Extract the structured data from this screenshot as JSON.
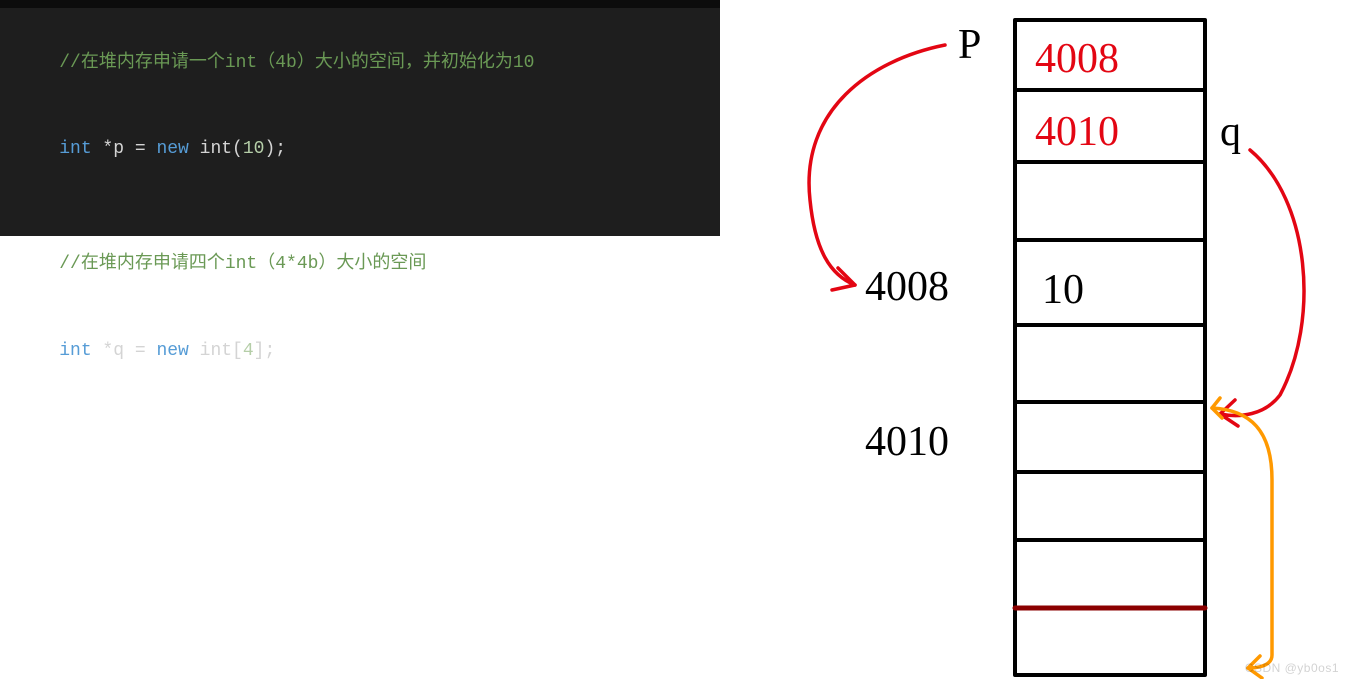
{
  "code": {
    "comment1": "//在堆内存申请一个int（4b）大小的空间，并初始化为10",
    "line1_type": "int",
    "line1_rest": " *p = ",
    "line1_new": "new",
    "line1_call": " int(",
    "line1_num": "10",
    "line1_end": ");",
    "comment2": "//在堆内存申请四个int（4*4b）大小的空间",
    "line2_type": "int",
    "line2_rest": " *q = ",
    "line2_new": "new",
    "line2_call": " int[",
    "line2_num": "4",
    "line2_end": "];"
  },
  "diagram": {
    "p_label": "P",
    "q_label": "q",
    "addr_p": "4008",
    "addr_q": "4010",
    "cell_p_value": "4008",
    "cell_q_value": "4010",
    "heap_value_10": "10"
  },
  "watermark": "CSDN @yb0os1"
}
